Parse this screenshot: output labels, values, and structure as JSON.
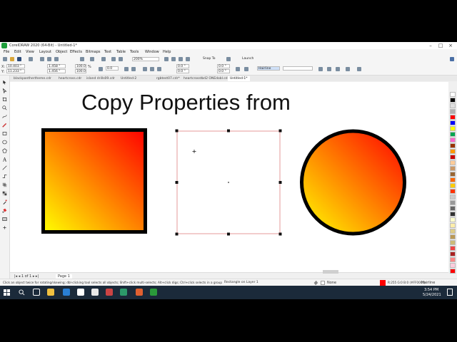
{
  "window": {
    "title": "CorelDRAW 2020 (64-Bit) - Untitled-1*"
  },
  "menu": [
    "File",
    "Edit",
    "View",
    "Layout",
    "Object",
    "Effects",
    "Bitmaps",
    "Text",
    "Table",
    "Tools",
    "Window",
    "Help"
  ],
  "toolbar": {
    "zoom": "200%",
    "snap_to": "Snap To",
    "launch": "Launch",
    "x": "10.403 \"",
    "y": "11.233 \"",
    "width": "1.458 \"",
    "height": "1.456 \"",
    "scale_w": "100.0",
    "scale_h": "100.0",
    "pct": "%",
    "angle": "0.0",
    "corner1": "0.0 \"",
    "corner2": "0.0 \"",
    "corner3": "0.0 \"",
    "corner4": "0.0 \"",
    "outline_width": "Hairline"
  },
  "doc_tabs": [
    {
      "label": "blackpanthertheme.cdr",
      "active": false
    },
    {
      "label": "heartcross.cdr",
      "active": false
    },
    {
      "label": "island drills09.cdr",
      "active": false
    },
    {
      "label": "Untitled-2",
      "active": false
    },
    {
      "label": "rgbtest07.cdr*",
      "active": false
    },
    {
      "label": "heartcrosstbd2 ONEdobl.cdr",
      "active": false
    },
    {
      "label": "Untitled-1*",
      "active": true
    }
  ],
  "canvas": {
    "heading": "Copy Properties from",
    "gradient_start": "#ffff00",
    "gradient_end": "#ff0000",
    "outline_color": "#000000"
  },
  "pagebar": {
    "page_label": "Page 1"
  },
  "status": {
    "hint": "Click an object twice for rotating/skewing; dbl-clicking tool selects all objects; Shift+click multi-selects; Alt+click digs; Ctrl+click selects in a group",
    "selection": "Rectangle on Layer 1",
    "fill_none": "None",
    "color_readout": "R:255 G:0 B:0 (#FF0000)",
    "outline": "Hairline"
  },
  "taskbar": {
    "time": "3:54 PM",
    "date": "5/24/2021"
  },
  "palette": [
    "#ffffff",
    "#000000",
    "#e0e0e0",
    "#b0b0b0",
    "#ff0000",
    "#0000ff",
    "#ffff00",
    "#00a650",
    "#ff66cc",
    "#993300",
    "#ff9900",
    "#cc0000",
    "#ffcc99",
    "#cc9966",
    "#996633",
    "#ff6600",
    "#ffcc00",
    "#ff3300",
    "#cccccc",
    "#999999",
    "#666666",
    "#333333",
    "#ffffcc",
    "#ffeeaa",
    "#ddcc88",
    "#bb9955",
    "#ccbb77",
    "#ee4444",
    "#aa2222",
    "#ff8888",
    "#ffccdd",
    "#ff0000"
  ]
}
